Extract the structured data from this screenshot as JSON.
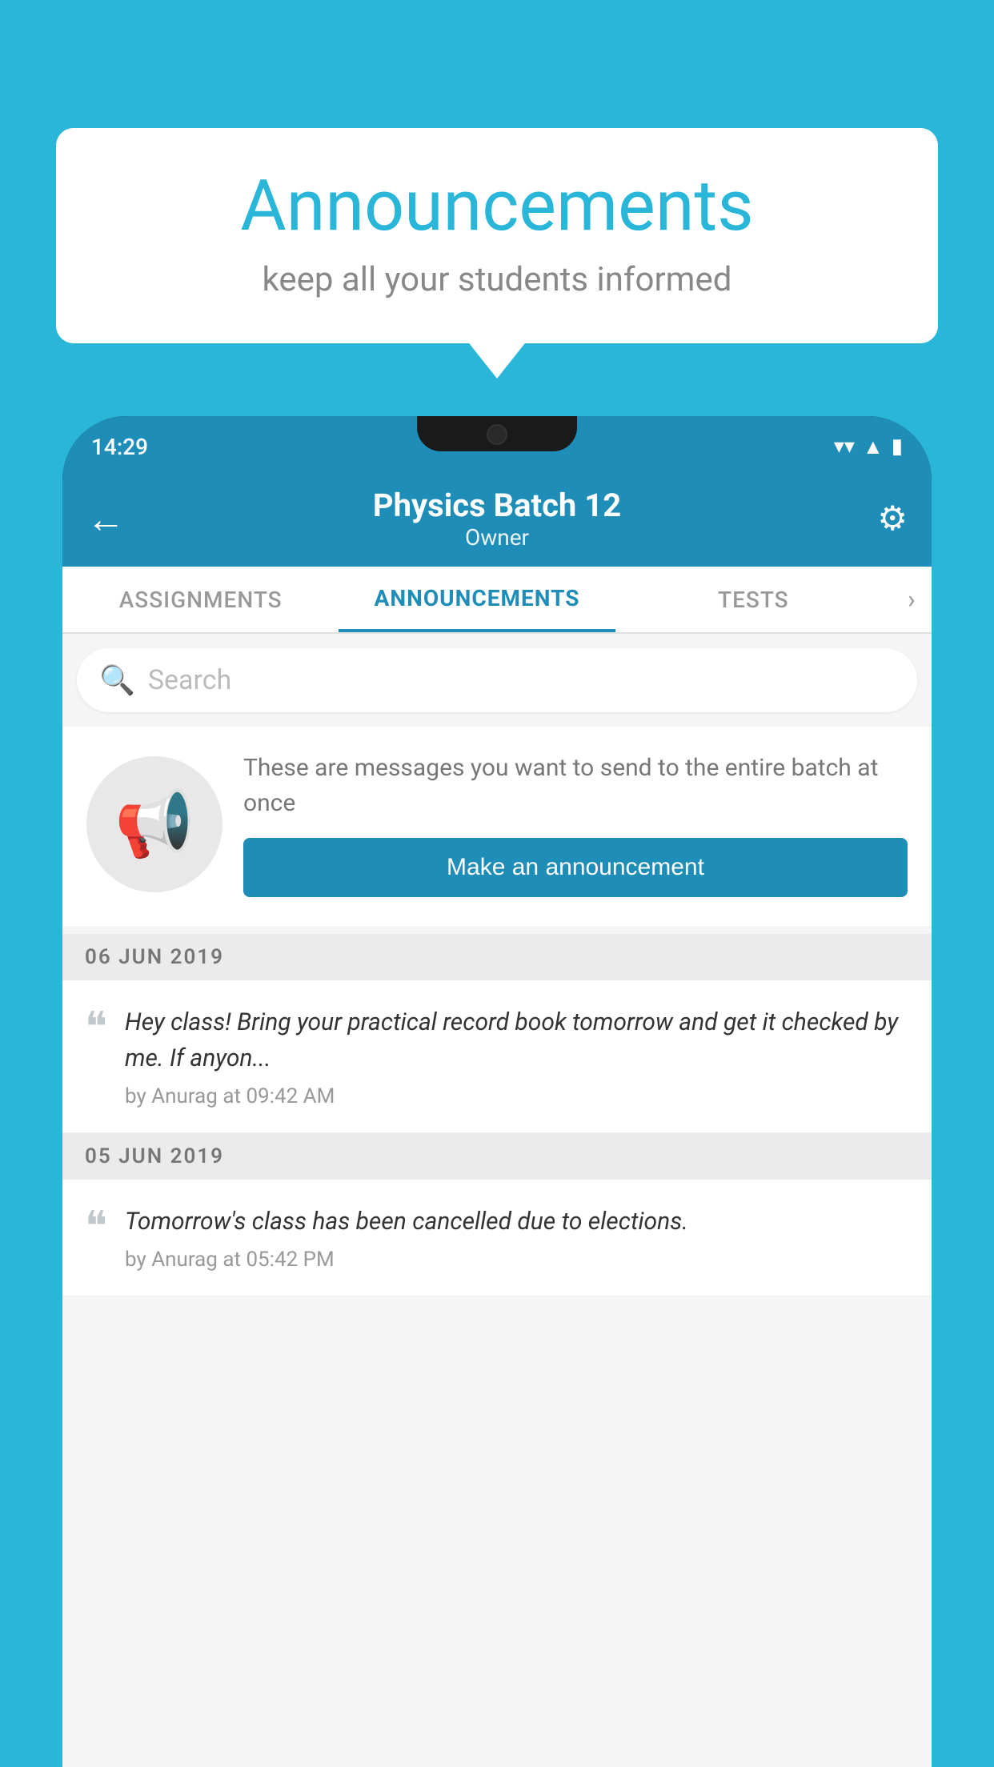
{
  "background_color": "#29b6d8",
  "speech_bubble": {
    "title": "Announcements",
    "subtitle": "keep all your students informed"
  },
  "status_bar": {
    "time": "14:29",
    "icons": [
      "wifi",
      "signal",
      "battery"
    ]
  },
  "app_bar": {
    "title": "Physics Batch 12",
    "subtitle": "Owner",
    "back_label": "←",
    "settings_label": "⚙"
  },
  "tabs": [
    {
      "label": "ASSIGNMENTS",
      "active": false
    },
    {
      "label": "ANNOUNCEMENTS",
      "active": true
    },
    {
      "label": "TESTS",
      "active": false
    }
  ],
  "search": {
    "placeholder": "Search"
  },
  "announcement_prompt": {
    "description": "These are messages you want to send to the entire batch at once",
    "button_label": "Make an announcement"
  },
  "date_groups": [
    {
      "date": "06  JUN  2019",
      "items": [
        {
          "text": "Hey class! Bring your practical record book tomorrow and get it checked by me. If anyon...",
          "meta": "by Anurag at 09:42 AM"
        }
      ]
    },
    {
      "date": "05  JUN  2019",
      "items": [
        {
          "text": "Tomorrow's class has been cancelled due to elections.",
          "meta": "by Anurag at 05:42 PM"
        }
      ]
    }
  ]
}
